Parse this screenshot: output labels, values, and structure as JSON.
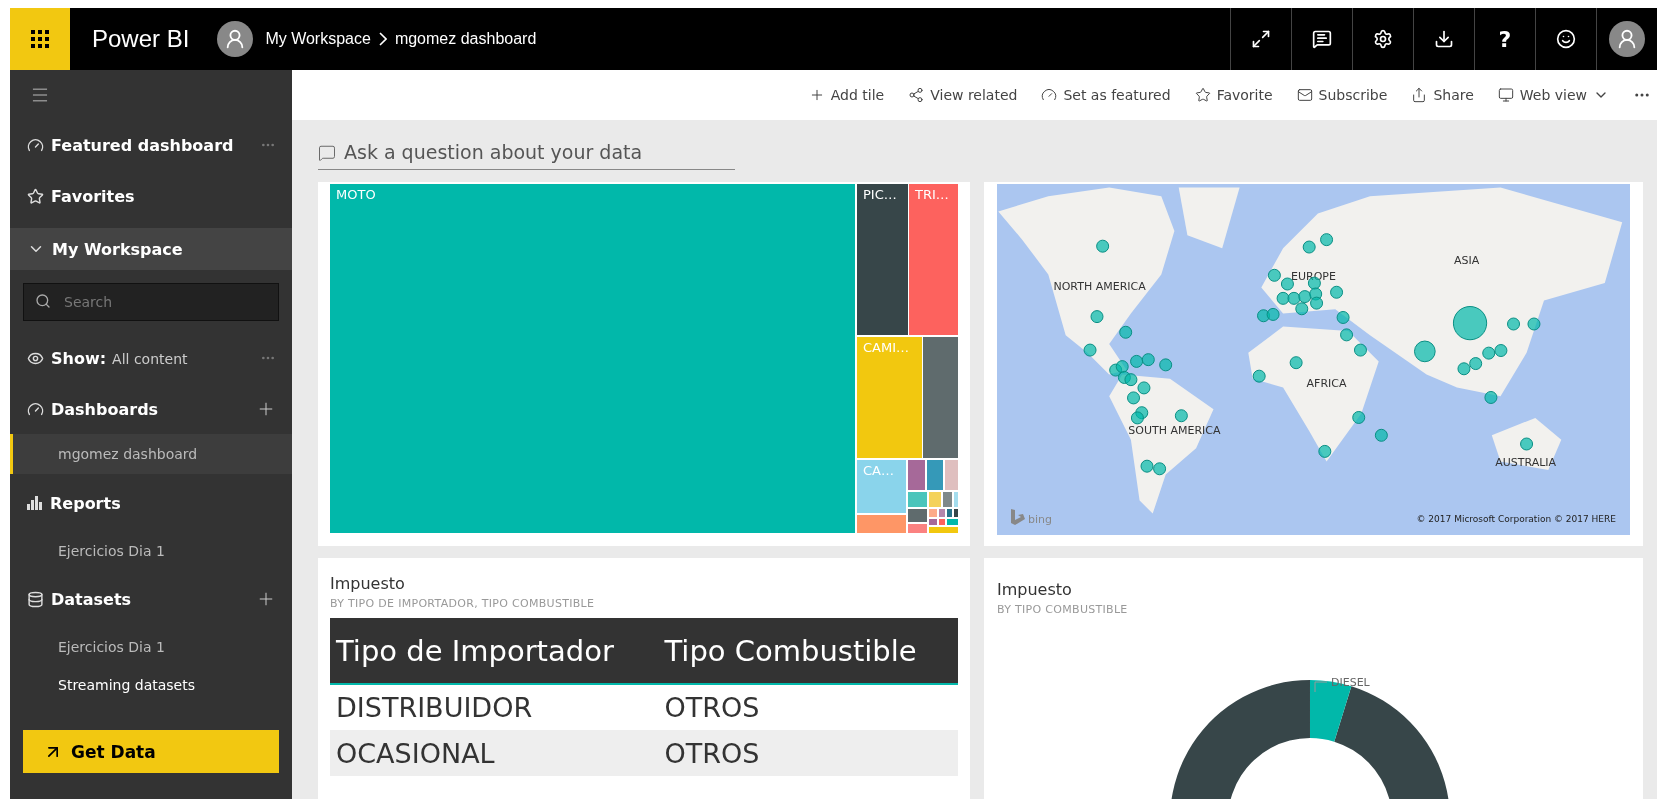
{
  "header": {
    "app_name": "Power BI",
    "breadcrumb": [
      {
        "label": "My Workspace"
      },
      {
        "label": "mgomez dashboard"
      }
    ],
    "help_label": "?"
  },
  "toolbar": [
    {
      "kind": "add",
      "label": "Add tile"
    },
    {
      "kind": "related",
      "label": "View related"
    },
    {
      "kind": "featured",
      "label": "Set as featured"
    },
    {
      "kind": "favorite",
      "label": "Favorite"
    },
    {
      "kind": "subscribe",
      "label": "Subscribe"
    },
    {
      "kind": "share",
      "label": "Share"
    },
    {
      "kind": "view",
      "label": "Web view"
    }
  ],
  "sidebar": {
    "items": [
      {
        "kind": "featured",
        "label": "Featured dashboard"
      },
      {
        "kind": "favorites",
        "label": "Favorites"
      },
      {
        "kind": "workspace",
        "label": "My Workspace",
        "expanded": true
      }
    ],
    "search": {
      "placeholder": "Search"
    },
    "show": {
      "label": "Show:",
      "value": "All content"
    },
    "sections": [
      {
        "kind": "dashboards",
        "label": "Dashboards",
        "addable": true,
        "children": [
          {
            "label": "mgomez dashboard",
            "selected": true,
            "kind": "item"
          }
        ]
      },
      {
        "kind": "reports",
        "label": "Reports",
        "addable": false,
        "children": [
          {
            "label": "Ejercicios Dia 1",
            "selected": false,
            "kind": "item"
          }
        ]
      },
      {
        "kind": "datasets",
        "label": "Datasets",
        "addable": true,
        "children": [
          {
            "label": "Ejercicios Dia 1",
            "selected": false,
            "kind": "item"
          },
          {
            "label": "Streaming datasets",
            "selected": false,
            "kind": "action"
          }
        ]
      }
    ],
    "get_data": "Get Data"
  },
  "qa": {
    "placeholder": "Ask a question about your data"
  },
  "tiles": [
    {
      "kind": "treemap",
      "labels": [
        "MOTO",
        "PIC…",
        "TRI…",
        "CAMI…",
        "CA…"
      ]
    },
    {
      "kind": "map",
      "regions": [
        "NORTH AMERICA",
        "EUROPE",
        "ASIA",
        "AFRICA",
        "SOUTH AMERICA",
        "AUSTRALIA"
      ],
      "logo": "bing",
      "attribution": [
        "© 2017 Microsoft Corporation",
        "© 2017 HERE"
      ]
    },
    {
      "kind": "table",
      "title": "Impuesto",
      "subtitle": "BY TIPO DE IMPORTADOR, TIPO COMBUSTIBLE",
      "columns": [
        "Tipo de Importador",
        "Tipo Combustible"
      ],
      "rows": [
        [
          "DISTRIBUIDOR",
          "OTROS"
        ],
        [
          "OCASIONAL",
          "OTROS"
        ]
      ]
    },
    {
      "kind": "donut",
      "title": "Impuesto",
      "subtitle": "BY TIPO COMBUSTIBLE",
      "slice_label": "DIESEL"
    }
  ]
}
